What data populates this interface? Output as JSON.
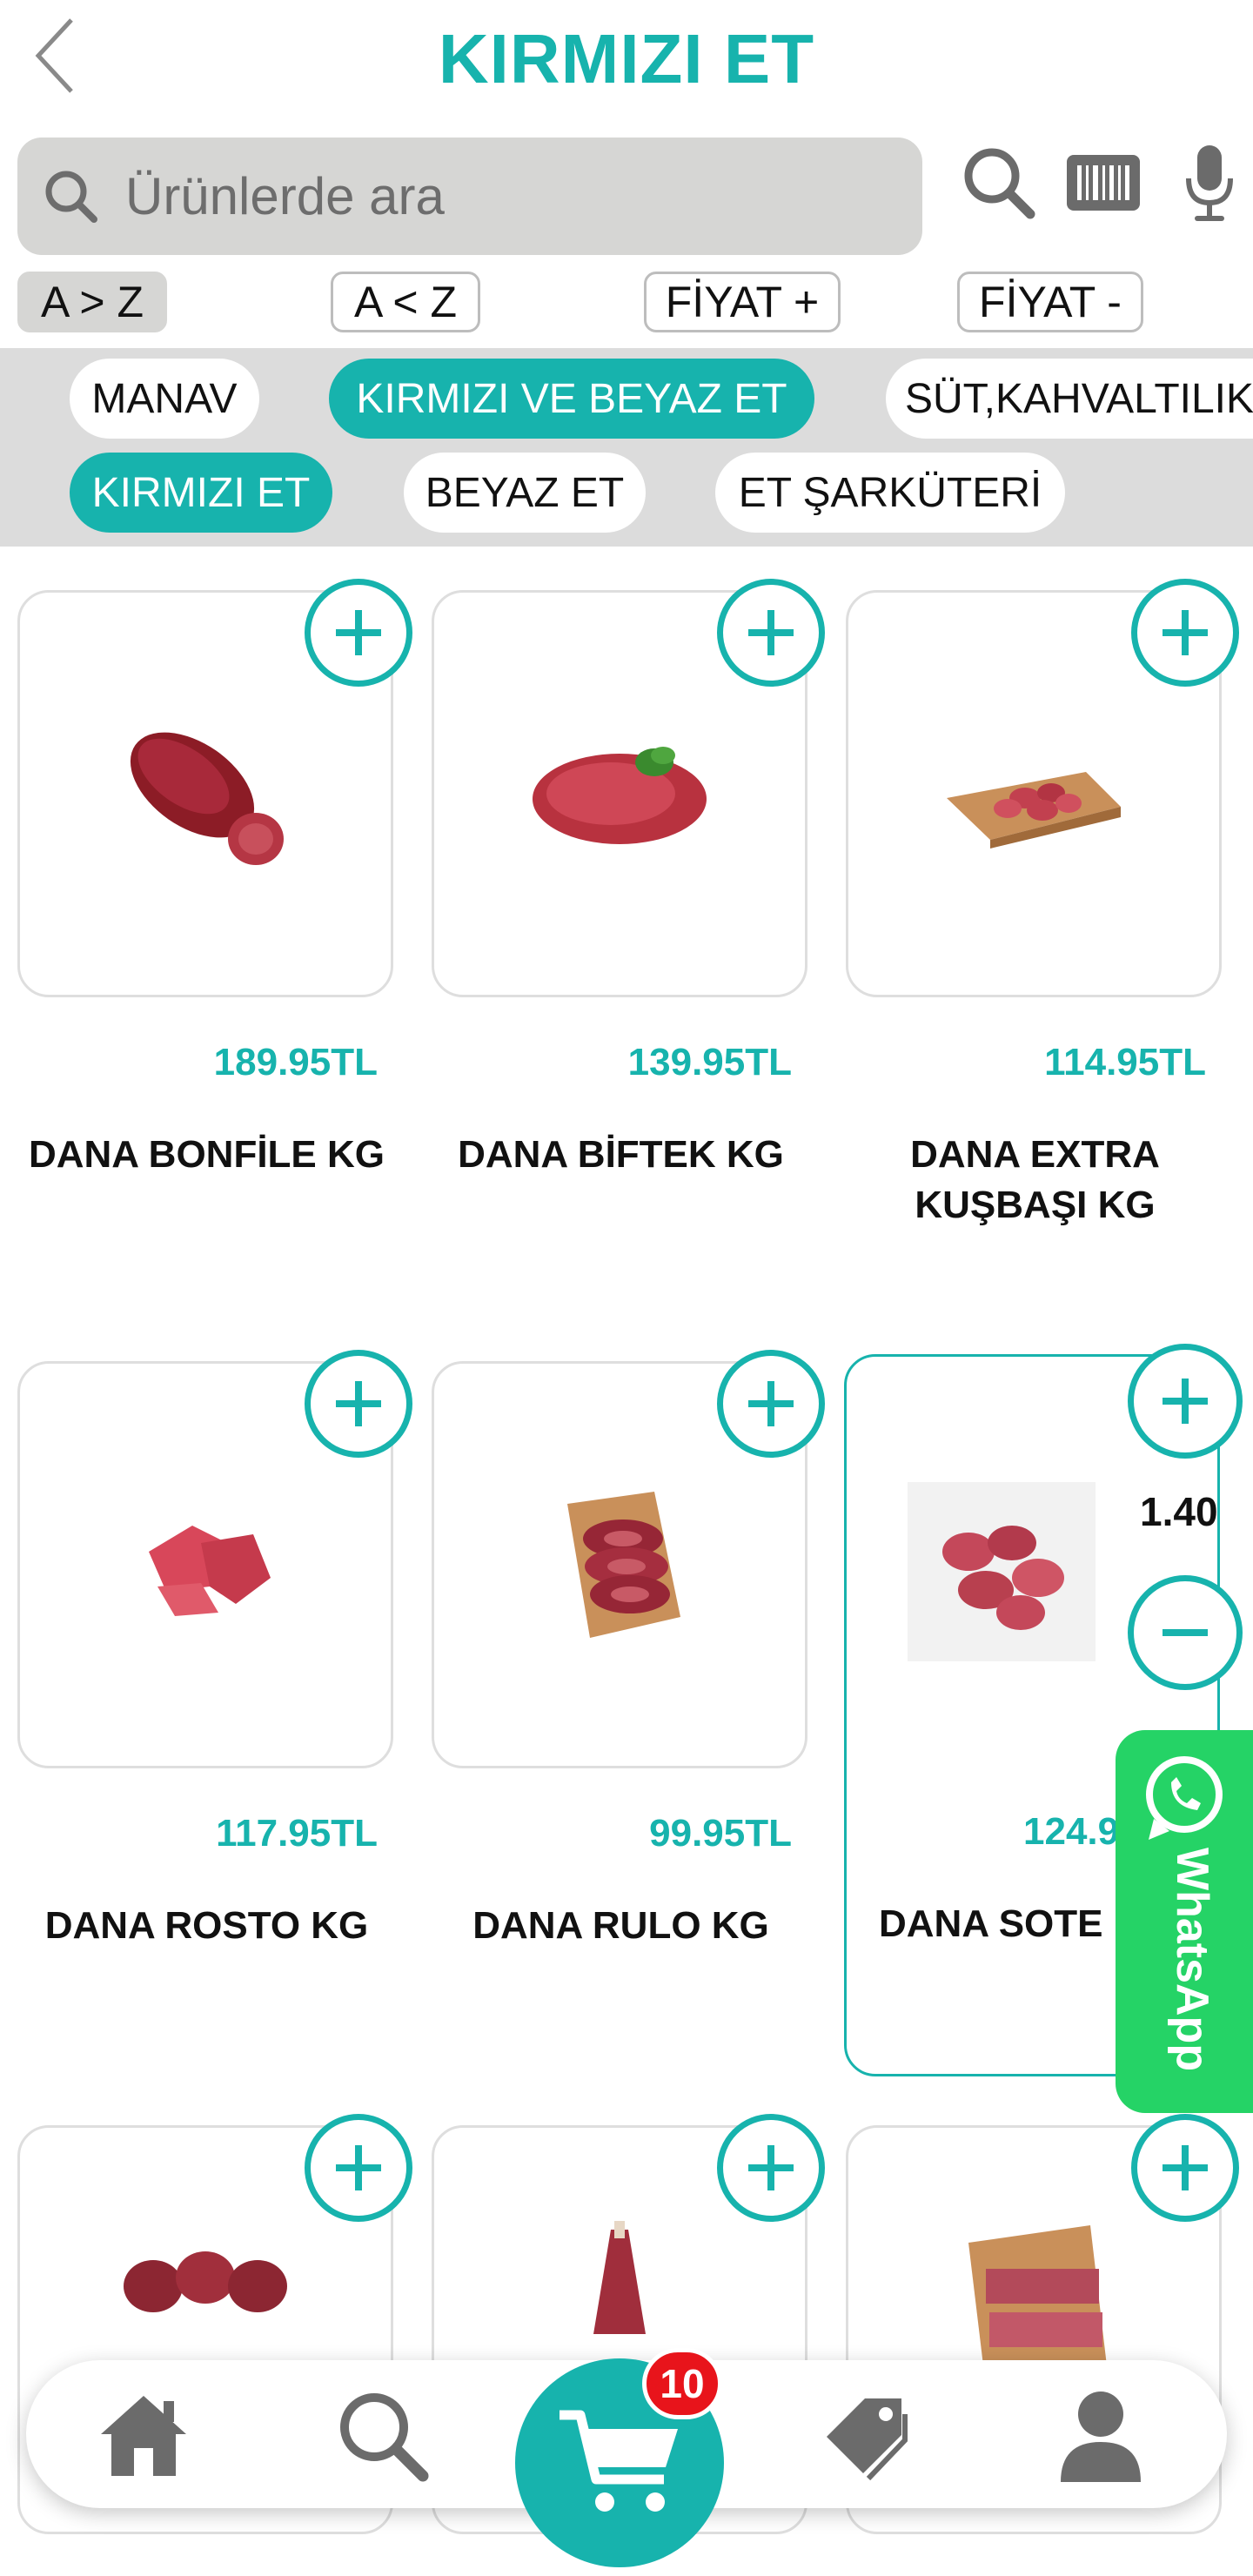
{
  "header": {
    "title": "KIRMIZI ET"
  },
  "search": {
    "placeholder": "Ürünlerde ara"
  },
  "sort": {
    "az": "A > Z",
    "za": "A < Z",
    "price_up": "FİYAT +",
    "price_down": "FİYAT -"
  },
  "categories": {
    "row1": [
      "MANAV",
      "KIRMIZI VE BEYAZ ET",
      "SÜT,KAHVALTILIK"
    ],
    "row2": [
      "KIRMIZI ET",
      "BEYAZ ET",
      "ET ŞARKÜTERİ"
    ]
  },
  "products": [
    {
      "name": "DANA BONFİLE KG",
      "price": "189.95TL"
    },
    {
      "name": "DANA BİFTEK KG",
      "price": "139.95TL"
    },
    {
      "name_line1": "DANA EXTRA",
      "name_line2": "KUŞBAŞI KG",
      "price": "114.95TL"
    },
    {
      "name": "DANA ROSTO KG",
      "price": "117.95TL"
    },
    {
      "name": "DANA RULO KG",
      "price": "99.95TL"
    },
    {
      "name": "DANA SOTE",
      "price": "124.9",
      "quantity": "1.40"
    }
  ],
  "whatsapp": {
    "label": "WhatsApp"
  },
  "cart": {
    "badge": "10"
  },
  "colors": {
    "accent": "#17b3ad",
    "badge": "#e8141b",
    "whatsapp": "#25d366"
  },
  "icons": [
    "back-icon",
    "search-icon",
    "barcode-icon",
    "microphone-icon",
    "plus-icon",
    "minus-icon",
    "whatsapp-icon",
    "home-icon",
    "tag-icon",
    "user-icon",
    "cart-icon"
  ]
}
